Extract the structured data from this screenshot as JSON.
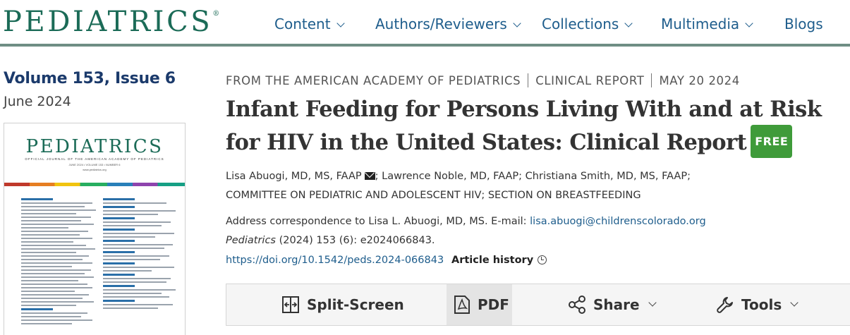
{
  "header": {
    "logo": "PEDIATRICS",
    "logo_mark": "®",
    "nav": [
      {
        "label": "Content",
        "dropdown": true
      },
      {
        "label": "Authors/Reviewers",
        "dropdown": true
      },
      {
        "label": "Collections",
        "dropdown": true
      },
      {
        "label": "Multimedia",
        "dropdown": true
      },
      {
        "label": "Blogs",
        "dropdown": false
      }
    ]
  },
  "issue": {
    "volume": "Volume 153, Issue 6",
    "date": "June 2024",
    "cover": {
      "logo": "PEDIATRICS",
      "subtitle": "OFFICIAL JOURNAL OF THE AMERICAN ACADEMY OF PEDIATRICS",
      "date_line": "JUNE 2024 • VOLUME 153 • NUMBER 6",
      "url": "www.pediatrics.org"
    }
  },
  "article": {
    "kicker": [
      "FROM THE AMERICAN ACADEMY OF PEDIATRICS",
      "CLINICAL REPORT",
      "MAY 20 2024"
    ],
    "title": "Infant Feeding for Persons Living With and at Risk for HIV in the United States: Clinical Report",
    "free_badge": "FREE",
    "author_1": "Lisa Abuogi, MD, MS, FAAP",
    "authors_rest": "; Lawrence Noble, MD, FAAP; Christiana Smith, MD, MS, FAAP;",
    "committees": "COMMITTEE ON PEDIATRIC AND ADOLESCENT HIV; SECTION ON BREASTFEEDING",
    "correspondence_text": "Address correspondence to Lisa L. Abuogi, MD, MS. E-mail: ",
    "correspondence_email": "lisa.abuogi@childrenscolorado.org",
    "journal": "Pediatrics",
    "citation": " (2024) 153 (6): e2024066843.",
    "doi": "https://doi.org/10.1542/peds.2024-066843",
    "history_label": "Article history"
  },
  "toolbar": {
    "split_screen": "Split-Screen",
    "pdf": "PDF",
    "share": "Share",
    "tools": "Tools"
  },
  "colors": {
    "brand_green": "#1b6b57",
    "link_blue": "#1e5d8c",
    "volume_navy": "#1b3a6b",
    "free_green": "#3f9b3a",
    "header_rule": "#6f8e84"
  }
}
